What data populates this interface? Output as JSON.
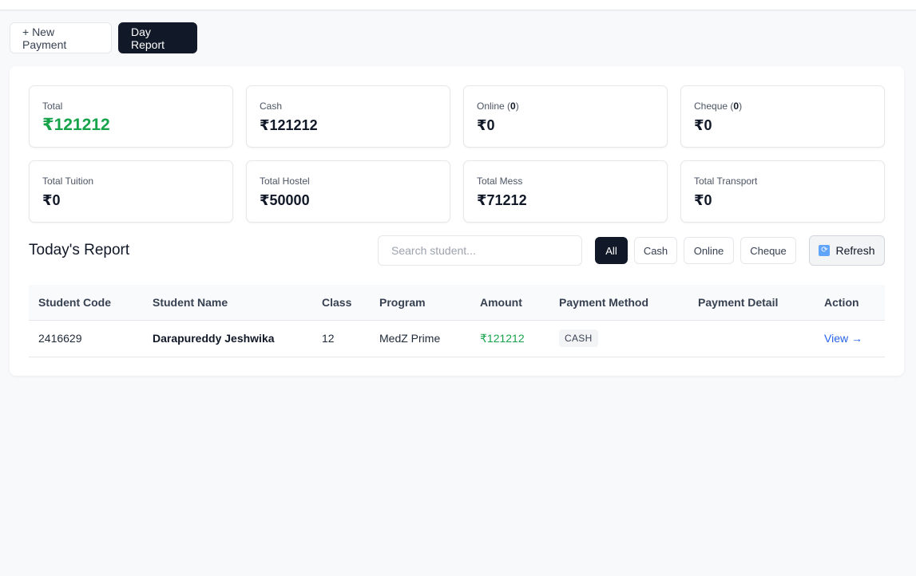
{
  "tabs": {
    "new_payment": "+ New Payment",
    "day_report": "Day Report"
  },
  "stats": [
    {
      "label": "Total",
      "value": "₹121212",
      "count": ""
    },
    {
      "label": "Cash",
      "value": "₹121212",
      "count": ""
    },
    {
      "label": "Online",
      "value": "₹0",
      "count": "0"
    },
    {
      "label": "Cheque",
      "value": "₹0",
      "count": "0"
    },
    {
      "label": "Total Tuition",
      "value": "₹0",
      "count": ""
    },
    {
      "label": "Total Hostel",
      "value": "₹50000",
      "count": ""
    },
    {
      "label": "Total Mess",
      "value": "₹71212",
      "count": ""
    },
    {
      "label": "Total Transport",
      "value": "₹0",
      "count": ""
    }
  ],
  "report": {
    "title": "Today's Report",
    "search_placeholder": "Search student...",
    "filters": [
      "All",
      "Cash",
      "Online",
      "Cheque"
    ],
    "active_filter": "All",
    "refresh_label": "Refresh"
  },
  "table": {
    "columns": [
      "Student Code",
      "Student Name",
      "Class",
      "Program",
      "Amount",
      "Payment Method",
      "Payment Detail",
      "Action"
    ],
    "rows": [
      {
        "code": "2416629",
        "name": "Darapureddy Jeshwika",
        "class": "12",
        "program": "MedZ Prime",
        "amount": "₹121212",
        "method": "CASH",
        "detail": "",
        "action": "View →"
      }
    ]
  },
  "colors": {
    "accent_dark": "#111827",
    "money_green": "#16a34a",
    "link_blue": "#2563eb"
  }
}
